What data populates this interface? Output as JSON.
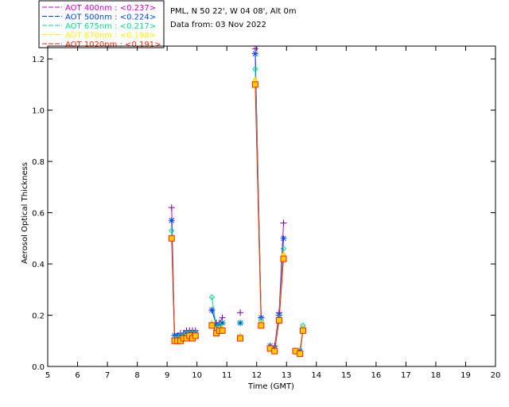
{
  "chart_data": {
    "type": "line",
    "info": {
      "station": "PML, N 50 22', W 04 08', Alt 0m",
      "date": "Data from: 03 Nov 2022"
    },
    "xlabel": "Time (GMT)",
    "ylabel": "Aerosol Optical Thickness",
    "xlim": [
      5,
      20
    ],
    "ylim": [
      0,
      1.25
    ],
    "xticks": [
      5,
      6,
      7,
      8,
      9,
      10,
      11,
      12,
      13,
      14,
      15,
      16,
      17,
      18,
      19,
      20
    ],
    "yticks": [
      0.0,
      0.2,
      0.4,
      0.6,
      0.8,
      1.0,
      1.2
    ],
    "ytick_labels": [
      "0.0",
      "0.2",
      "0.4",
      "0.6",
      "0.8",
      "1.0",
      "1.2"
    ],
    "legend_position": "top-left",
    "grid": false,
    "segments": [
      [
        9.15,
        9.25,
        9.35,
        9.45,
        9.55,
        9.65,
        9.75,
        9.85,
        9.95
      ],
      [
        10.5,
        10.65,
        10.75,
        10.85
      ],
      [
        11.45
      ],
      [
        11.95,
        12.15
      ],
      [
        12.45,
        12.6,
        12.75,
        12.9
      ],
      [
        13.3,
        13.45,
        13.55
      ]
    ],
    "series": [
      {
        "legend": "AOT  400nm : <0.237>",
        "color": "#cc00cc",
        "marker": "plus",
        "x": [
          9.15,
          9.25,
          9.35,
          9.45,
          9.55,
          9.65,
          9.75,
          9.85,
          9.95,
          10.5,
          10.65,
          10.75,
          10.85,
          11.45,
          11.95,
          12.15,
          12.45,
          12.6,
          12.75,
          12.9,
          13.3,
          13.45,
          13.55
        ],
        "values": [
          0.62,
          0.12,
          0.12,
          0.13,
          0.13,
          0.14,
          0.14,
          0.14,
          0.14,
          0.22,
          0.17,
          0.17,
          0.19,
          0.21,
          1.24,
          0.19,
          0.08,
          0.08,
          0.21,
          0.56,
          0.06,
          0.06,
          0.15
        ]
      },
      {
        "legend": "AOT  500nm : <0.224>",
        "color": "#0044ff",
        "marker": "asterisk",
        "x": [
          9.15,
          9.25,
          9.35,
          9.45,
          9.55,
          9.65,
          9.75,
          9.85,
          9.95,
          10.5,
          10.65,
          10.75,
          10.85,
          11.45,
          11.95,
          12.15,
          12.45,
          12.6,
          12.75,
          12.9,
          13.3,
          13.45,
          13.55
        ],
        "values": [
          0.57,
          0.12,
          0.12,
          0.12,
          0.12,
          0.13,
          0.13,
          0.13,
          0.13,
          0.22,
          0.16,
          0.16,
          0.17,
          0.17,
          1.22,
          0.19,
          0.08,
          0.07,
          0.2,
          0.5,
          0.06,
          0.06,
          0.15
        ]
      },
      {
        "legend": "AOT  675nm : <0.217>",
        "color": "#00dd88",
        "marker": "diamond",
        "x": [
          9.15,
          9.25,
          9.35,
          9.45,
          9.55,
          9.65,
          9.75,
          9.85,
          9.95,
          10.5,
          10.65,
          10.75,
          10.85,
          11.45,
          11.95,
          12.15,
          12.45,
          12.6,
          12.75,
          12.9,
          13.3,
          13.45,
          13.55
        ],
        "values": [
          0.53,
          0.11,
          0.11,
          0.12,
          0.12,
          0.13,
          0.13,
          0.13,
          0.13,
          0.27,
          0.15,
          0.16,
          0.17,
          0.17,
          1.16,
          0.18,
          0.07,
          0.07,
          0.19,
          0.46,
          0.06,
          0.06,
          0.16
        ]
      },
      {
        "legend": "AOT  870nm : <0.198>",
        "color": "#ffee00",
        "marker": "triangle",
        "x": [
          9.15,
          9.25,
          9.35,
          9.45,
          9.55,
          9.65,
          9.75,
          9.85,
          9.95,
          10.5,
          10.65,
          10.75,
          10.85,
          11.45,
          11.95,
          12.15,
          12.45,
          12.6,
          12.75,
          12.9,
          13.3,
          13.45,
          13.55
        ],
        "values": [
          0.5,
          0.1,
          0.1,
          0.11,
          0.11,
          0.12,
          0.12,
          0.12,
          0.12,
          0.17,
          0.14,
          0.15,
          0.15,
          0.12,
          1.12,
          0.17,
          0.07,
          0.06,
          0.18,
          0.44,
          0.06,
          0.05,
          0.15
        ]
      },
      {
        "legend": "AOT 1020nm : <0.191>",
        "color": "#ff2200",
        "marker": "square",
        "x": [
          9.15,
          9.25,
          9.35,
          9.45,
          9.55,
          9.65,
          9.75,
          9.85,
          9.95,
          10.5,
          10.65,
          10.75,
          10.85,
          11.45,
          11.95,
          12.15,
          12.45,
          12.6,
          12.75,
          12.9,
          13.3,
          13.45,
          13.55
        ],
        "values": [
          0.5,
          0.1,
          0.1,
          0.1,
          0.11,
          0.11,
          0.12,
          0.11,
          0.12,
          0.16,
          0.13,
          0.14,
          0.14,
          0.11,
          1.1,
          0.16,
          0.07,
          0.06,
          0.18,
          0.42,
          0.06,
          0.05,
          0.14
        ]
      }
    ]
  }
}
